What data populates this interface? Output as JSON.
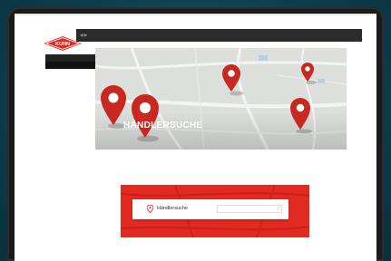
{
  "browser": {
    "url": "",
    "nav_glyphs": "‹ ›"
  },
  "topbar": {
    "util_1": "",
    "util_2": "",
    "util_3": ""
  },
  "logo": {
    "text": "KUHN"
  },
  "sidenav": {
    "items": [
      {
        "label": ""
      },
      {
        "label": ""
      }
    ]
  },
  "hero": {
    "title": "HÄNDLERSUCHE"
  },
  "intro": {
    "line_1": "",
    "line_2": ""
  },
  "banner": {
    "map_label": "",
    "search_label": "Händlersuche",
    "search_placeholder": "",
    "search_button_glyph": "›"
  },
  "colors": {
    "brand_red": "#e12b22",
    "dark_bar": "#2b2b2b",
    "background": "#0d3f4e"
  }
}
